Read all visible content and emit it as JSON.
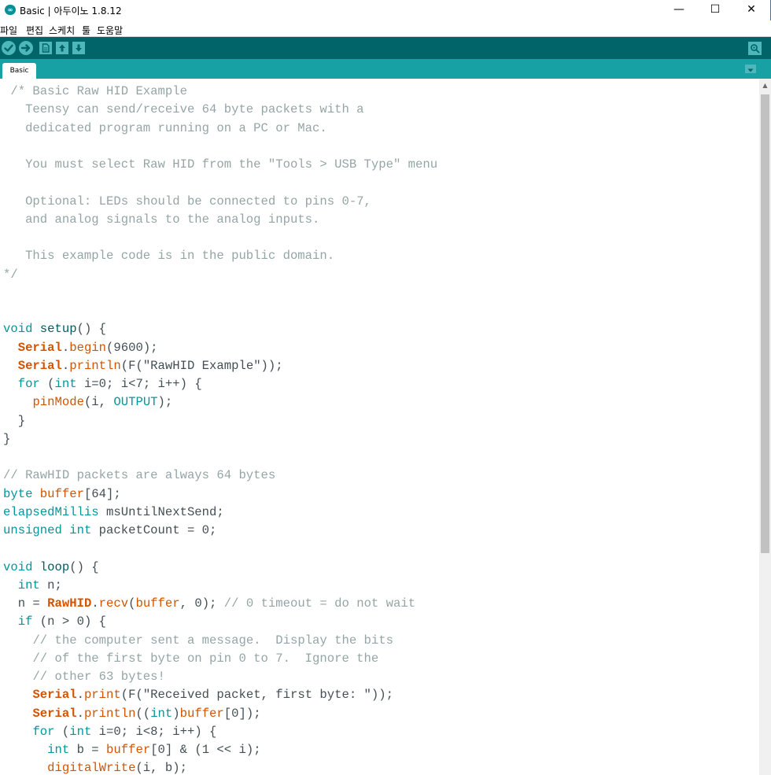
{
  "window": {
    "title": "Basic | 아두이노 1.8.12",
    "minimize_glyph": "—",
    "maximize_glyph": "☐",
    "close_glyph": "✕",
    "logo_text": "∞"
  },
  "menu": [
    "파일",
    "편집",
    "스케치",
    "툴",
    "도움말"
  ],
  "toolbar": {
    "buttons": [
      "verify-icon",
      "upload-icon",
      "new-icon",
      "open-icon",
      "save-icon"
    ],
    "serial_monitor": "serial-monitor-icon"
  },
  "tabs": [
    {
      "label": "Basic"
    }
  ],
  "tab_menu_glyph": "▾",
  "editor": {
    "colors": {
      "comment": "#95a5a6",
      "keyword": "#00979c",
      "function": "#d35400",
      "plain": "#434f54"
    },
    "lines": [
      [
        [
          "cm",
          " /* Basic Raw HID Example"
        ]
      ],
      [
        [
          "cm",
          "   Teensy can send/receive 64 byte packets with a"
        ]
      ],
      [
        [
          "cm",
          "   dedicated program running on a PC or Mac."
        ]
      ],
      [
        [
          "cm",
          ""
        ]
      ],
      [
        [
          "cm",
          "   You must select Raw HID from the \"Tools > USB Type\" menu"
        ]
      ],
      [
        [
          "cm",
          ""
        ]
      ],
      [
        [
          "cm",
          "   Optional: LEDs should be connected to pins 0-7,"
        ]
      ],
      [
        [
          "cm",
          "   and analog signals to the analog inputs."
        ]
      ],
      [
        [
          "cm",
          ""
        ]
      ],
      [
        [
          "cm",
          "   This example code is in the public domain."
        ]
      ],
      [
        [
          "cm",
          "*/"
        ]
      ],
      [],
      [],
      [
        [
          "kw",
          "void"
        ],
        [
          "",
          " "
        ],
        [
          "sb",
          "setup"
        ],
        [
          "",
          "() {"
        ]
      ],
      [
        [
          "",
          "  "
        ],
        [
          "fnb",
          "Serial"
        ],
        [
          "",
          "."
        ],
        [
          "fn",
          "begin"
        ],
        [
          "",
          "(9600);"
        ]
      ],
      [
        [
          "",
          "  "
        ],
        [
          "fnb",
          "Serial"
        ],
        [
          "",
          "."
        ],
        [
          "fn",
          "println"
        ],
        [
          "",
          "(F(\"RawHID Example\"));"
        ]
      ],
      [
        [
          "",
          "  "
        ],
        [
          "kw",
          "for"
        ],
        [
          "",
          " ("
        ],
        [
          "kw",
          "int"
        ],
        [
          "",
          " i=0; i<7; i++) {"
        ]
      ],
      [
        [
          "",
          "    "
        ],
        [
          "fn",
          "pinMode"
        ],
        [
          "",
          "(i, "
        ],
        [
          "kw",
          "OUTPUT"
        ],
        [
          "",
          ");"
        ]
      ],
      [
        [
          "",
          "  }"
        ]
      ],
      [
        [
          "",
          "}"
        ]
      ],
      [],
      [
        [
          "cm",
          "// RawHID packets are always 64 bytes"
        ]
      ],
      [
        [
          "kw",
          "byte"
        ],
        [
          "",
          " "
        ],
        [
          "fn",
          "buffer"
        ],
        [
          "",
          "[64];"
        ]
      ],
      [
        [
          "kw",
          "elapsedMillis"
        ],
        [
          "",
          " msUntilNextSend;"
        ]
      ],
      [
        [
          "kw",
          "unsigned"
        ],
        [
          "",
          " "
        ],
        [
          "kw",
          "int"
        ],
        [
          "",
          " packetCount = 0;"
        ]
      ],
      [],
      [
        [
          "kw",
          "void"
        ],
        [
          "",
          " "
        ],
        [
          "sb",
          "loop"
        ],
        [
          "",
          "() {"
        ]
      ],
      [
        [
          "",
          "  "
        ],
        [
          "kw",
          "int"
        ],
        [
          "",
          " n;"
        ]
      ],
      [
        [
          "",
          "  n = "
        ],
        [
          "fnb",
          "RawHID"
        ],
        [
          "",
          "."
        ],
        [
          "fn",
          "recv"
        ],
        [
          "",
          "("
        ],
        [
          "fn",
          "buffer"
        ],
        [
          "",
          ", 0); "
        ],
        [
          "cm",
          "// 0 timeout = do not wait"
        ]
      ],
      [
        [
          "",
          "  "
        ],
        [
          "kw",
          "if"
        ],
        [
          "",
          " (n > 0) {"
        ]
      ],
      [
        [
          "",
          "    "
        ],
        [
          "cm",
          "// the computer sent a message.  Display the bits"
        ]
      ],
      [
        [
          "",
          "    "
        ],
        [
          "cm",
          "// of the first byte on pin 0 to 7.  Ignore the"
        ]
      ],
      [
        [
          "",
          "    "
        ],
        [
          "cm",
          "// other 63 bytes!"
        ]
      ],
      [
        [
          "",
          "    "
        ],
        [
          "fnb",
          "Serial"
        ],
        [
          "",
          "."
        ],
        [
          "fn",
          "print"
        ],
        [
          "",
          "(F(\"Received packet, first byte: \"));"
        ]
      ],
      [
        [
          "",
          "    "
        ],
        [
          "fnb",
          "Serial"
        ],
        [
          "",
          "."
        ],
        [
          "fn",
          "println"
        ],
        [
          "",
          "(("
        ],
        [
          "kw",
          "int"
        ],
        [
          "",
          ")"
        ],
        [
          "fn",
          "buffer"
        ],
        [
          "",
          "[0]);"
        ]
      ],
      [
        [
          "",
          "    "
        ],
        [
          "kw",
          "for"
        ],
        [
          "",
          " ("
        ],
        [
          "kw",
          "int"
        ],
        [
          "",
          " i=0; i<8; i++) {"
        ]
      ],
      [
        [
          "",
          "      "
        ],
        [
          "kw",
          "int"
        ],
        [
          "",
          " b = "
        ],
        [
          "fn",
          "buffer"
        ],
        [
          "",
          "[0] & (1 << i);"
        ]
      ],
      [
        [
          "",
          "      "
        ],
        [
          "fn",
          "digitalWrite"
        ],
        [
          "",
          "(i, b);"
        ]
      ]
    ]
  },
  "scrollbar": {
    "up_glyph": "▲",
    "position": 0.0
  }
}
